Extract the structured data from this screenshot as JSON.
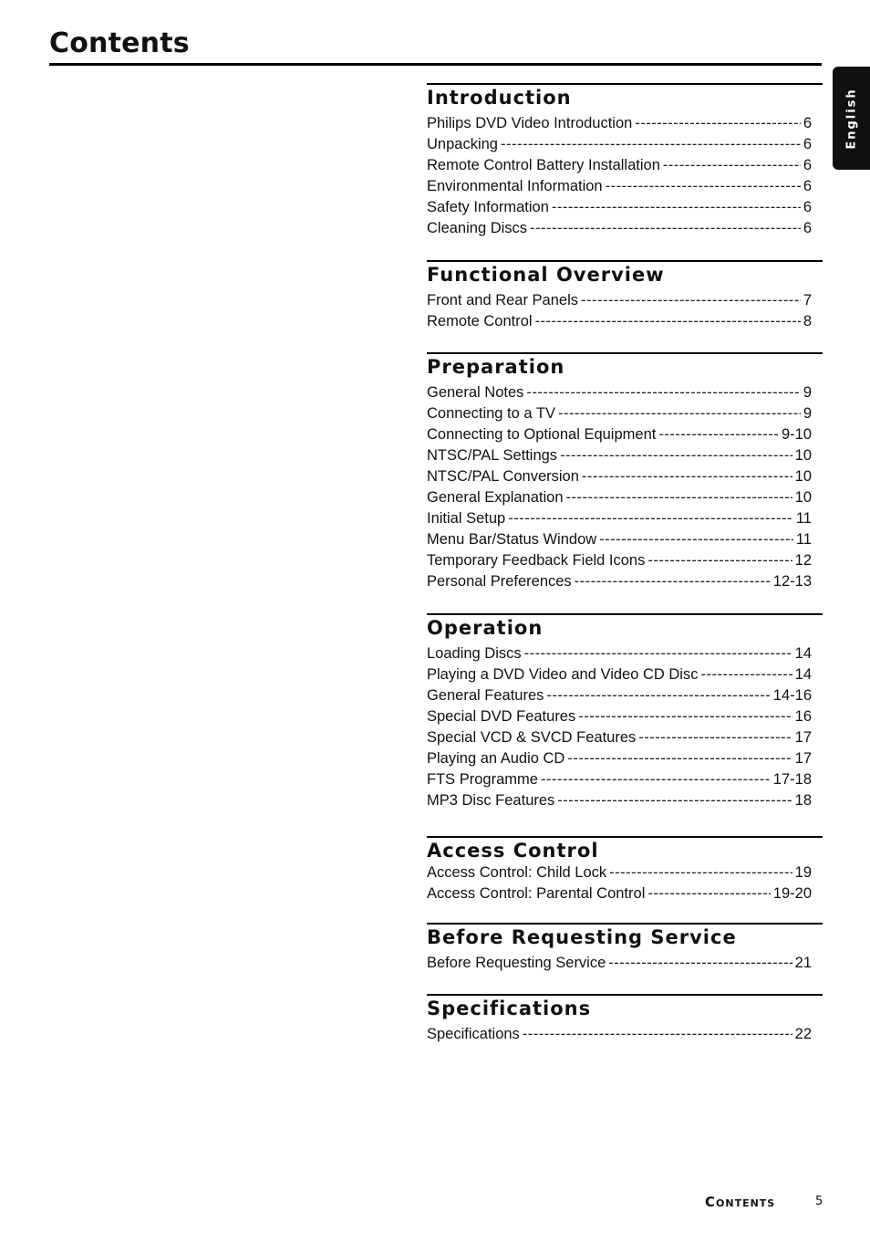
{
  "title": "Contents",
  "language_tab": "English",
  "sections": [
    {
      "heading": "Introduction",
      "entries": [
        {
          "label": "Philips DVD Video Introduction",
          "page": "6"
        },
        {
          "label": "Unpacking",
          "page": "6"
        },
        {
          "label": "Remote Control Battery Installation",
          "page": "6"
        },
        {
          "label": "Environmental Information",
          "page": "6"
        },
        {
          "label": "Safety Information",
          "page": "6"
        },
        {
          "label": "Cleaning Discs",
          "page": "6"
        }
      ]
    },
    {
      "heading": "Functional Overview",
      "entries": [
        {
          "label": "Front and Rear Panels",
          "page": "7"
        },
        {
          "label": "Remote Control",
          "page": "8"
        }
      ]
    },
    {
      "heading": "Preparation",
      "entries": [
        {
          "label": "General Notes",
          "page": "9"
        },
        {
          "label": "Connecting to a TV",
          "page": "9"
        },
        {
          "label": "Connecting to Optional Equipment",
          "page": "9-10"
        },
        {
          "label": "NTSC/PAL Settings",
          "page": "10"
        },
        {
          "label": "NTSC/PAL Conversion",
          "page": "10"
        },
        {
          "label": "General Explanation",
          "page": "10"
        },
        {
          "label": "Initial Setup",
          "page": "11"
        },
        {
          "label": "Menu Bar/Status Window",
          "page": "11"
        },
        {
          "label": "Temporary Feedback Field Icons",
          "page": "12"
        },
        {
          "label": "Personal Preferences",
          "page": "12-13"
        }
      ]
    },
    {
      "heading": "Operation",
      "entries": [
        {
          "label": "Loading Discs",
          "page": "14"
        },
        {
          "label": "Playing a DVD Video and Video CD Disc",
          "page": "14"
        },
        {
          "label": "General Features",
          "page": "14-16"
        },
        {
          "label": "Special DVD Features",
          "page": "16"
        },
        {
          "label": "Special VCD & SVCD Features",
          "page": "17"
        },
        {
          "label": "Playing an Audio CD",
          "page": "17"
        },
        {
          "label": "FTS Programme",
          "page": "17-18"
        },
        {
          "label": "MP3 Disc Features",
          "page": "18"
        }
      ]
    },
    {
      "heading": "Access Control",
      "entries": [
        {
          "label": "Access Control: Child Lock",
          "page": "19"
        },
        {
          "label": "Access Control: Parental Control",
          "page": "19-20"
        }
      ]
    },
    {
      "heading": "Before Requesting Service",
      "entries": [
        {
          "label": "Before Requesting Service",
          "page": "21"
        }
      ]
    },
    {
      "heading": "Specifications",
      "entries": [
        {
          "label": "Specifications",
          "page": "22"
        }
      ]
    }
  ],
  "footer": {
    "label": "Contents",
    "page_number": "5"
  }
}
